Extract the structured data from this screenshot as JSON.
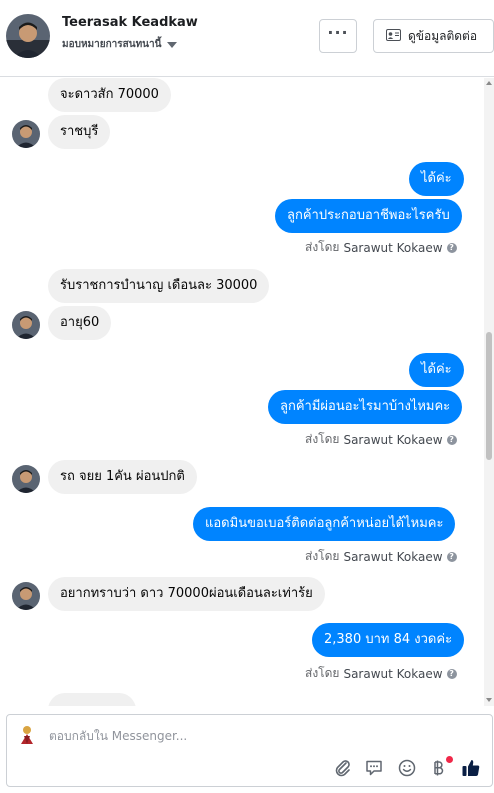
{
  "header": {
    "name": "Teerasak Keadkaw",
    "subtitle": "มอบหมายการสนทนานี้",
    "more_label": "···",
    "profile_label": "ดูข้อมูลติดต่อ"
  },
  "messages": [
    {
      "dir": "in",
      "text": "จะดาวสัก 70000"
    },
    {
      "dir": "in",
      "text": "ราชบุรี"
    },
    {
      "dir": "out",
      "text": "ได้ค่ะ"
    },
    {
      "dir": "out",
      "text": "ลูกค้าประกอบอาชีพอะไรครับ"
    },
    {
      "dir": "in",
      "text": "รับราชการบำนาญ เดือนละ 30000"
    },
    {
      "dir": "in",
      "text": "อายุ60"
    },
    {
      "dir": "out",
      "text": "ได้ค่ะ"
    },
    {
      "dir": "out",
      "text": "ลูกค้ามีผ่อนอะไรมาบ้างไหมคะ"
    },
    {
      "dir": "in",
      "text": "รถ จยย 1คัน ผ่อนปกติ"
    },
    {
      "dir": "out",
      "text": "แอดมินขอเบอร์ติดต่อลูกค้าหน่อยได้ไหมคะ"
    },
    {
      "dir": "in",
      "text": "อยากทราบว่า ดาว 70000ผ่อนเดือนละเท่าร้ย"
    },
    {
      "dir": "out",
      "text": "2,380 บาท 84 งวดค่ะ"
    }
  ],
  "sent_by": {
    "prefix": "ส่งโดย",
    "sender": "Sarawut Kokaew",
    "info": "?"
  },
  "composer": {
    "placeholder": "ตอบกลับใน Messenger..."
  },
  "colors": {
    "outgoing_bubble": "#0084ff",
    "incoming_bubble": "#f0f0f0",
    "like_icon": "#0a1f44",
    "notification_dot": "#f02849"
  },
  "icons": [
    "more-icon",
    "contact-card-icon",
    "attachment-icon",
    "sticker-icon",
    "emoji-icon",
    "baht-icon",
    "like-icon",
    "info-icon"
  ]
}
